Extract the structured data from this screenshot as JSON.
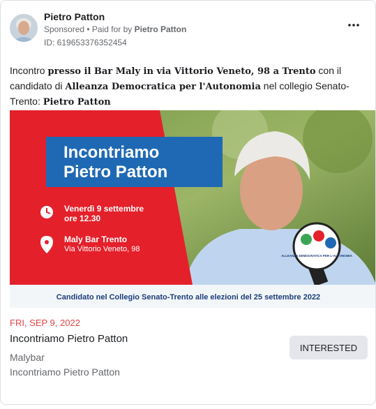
{
  "header": {
    "author": "Pietro Patton",
    "sponsored_label": "Sponsored",
    "paid_for_prefix": "Paid for by",
    "paid_for_by": "Pietro Patton",
    "ad_id": "ID: 619653376352454",
    "more_icon": "more-horizontal-icon"
  },
  "body": {
    "t1": "Incontro ",
    "b1": "presso il Bar Maly in via Vittorio Veneto, 98 a Trento",
    "t2": " con il candidato di ",
    "b2": "Alleanza Democratica per l'Autonomia",
    "t3": " nel collegio Senato-Trento: ",
    "b3": "Pietro Patton"
  },
  "creative": {
    "title_line1": "Incontriamo",
    "title_line2": "Pietro Patton",
    "date_line1": "Venerdì 9 settembre",
    "date_line2": "ore 12.30",
    "place_line1": "Maly Bar Trento",
    "place_line2": "Via Vittorio Veneto, 98",
    "footer": "Candidato nel Collegio Senato-Trento alle elezioni del 25 settembre 2022",
    "badge_text": "ALLEANZA DEMOCRATICA PER L'AUTONOMIA",
    "colors": {
      "red": "#e4202a",
      "blue": "#1f69b4",
      "navy": "#1d3c78"
    }
  },
  "event": {
    "date": "FRI, SEP 9, 2022",
    "title": "Incontriamo Pietro Patton",
    "location": "Malybar",
    "subtitle": "Incontriamo Pietro Patton",
    "button_label": "INTERESTED"
  }
}
